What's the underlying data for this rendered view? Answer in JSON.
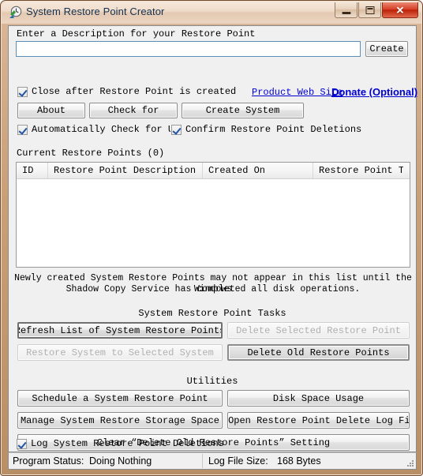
{
  "window": {
    "title": "System Restore Point Creator",
    "icon": "clock-restore-icon",
    "buttons": {
      "minimize": "minimize-button",
      "maximize": "maximize-button",
      "close_glyph": "✕"
    }
  },
  "description_section": {
    "label": "Enter a Description for your Restore Point",
    "input_value": "",
    "input_placeholder": "",
    "create_label": "Create"
  },
  "options": {
    "close_after": {
      "label": "Close after Restore Point is created",
      "checked": true
    },
    "auto_check_updates": {
      "label": "Automatically Check for Updat",
      "checked": true
    },
    "confirm_deletions": {
      "label": "Confirm Restore Point Deletions",
      "checked": true
    },
    "log_deletions": {
      "label": "Log System Restore Point Deletions",
      "checked": true
    }
  },
  "links": {
    "product_web_site": "Product Web Site",
    "donate": "Donate (Optional)"
  },
  "top_buttons": [
    {
      "label": "About",
      "enabled": true
    },
    {
      "label": "Check for",
      "enabled": true
    },
    {
      "label": "Create System",
      "enabled": true
    }
  ],
  "list_section": {
    "title": "Current Restore Points (0)",
    "columns": [
      "ID",
      "Restore Point Description",
      "Created On",
      "Restore Point Type"
    ],
    "rows": [],
    "note_line1": "Newly created System Restore Points may not appear in this list until the Windows",
    "note_line2": "Shadow Copy Service has completed all disk operations."
  },
  "tasks_section": {
    "title": "System Restore Point Tasks",
    "buttons": [
      {
        "label": "Refresh List of System Restore Points",
        "enabled": true,
        "focused": true
      },
      {
        "label": "Delete Selected Restore Point",
        "enabled": false,
        "focused": false
      },
      {
        "label": "Restore System to Selected System",
        "enabled": false,
        "focused": false
      },
      {
        "label": "Delete Old Restore Points",
        "enabled": true,
        "focused": true
      }
    ]
  },
  "utilities_section": {
    "title": "Utilities",
    "buttons": [
      {
        "label": "Schedule a System Restore Point",
        "enabled": true,
        "icon": ""
      },
      {
        "label": "Disk Space Usage",
        "enabled": true,
        "icon": ""
      },
      {
        "label": "Manage System Restore Storage Space",
        "enabled": true,
        "icon": ""
      },
      {
        "label": "Open Restore Point Delete Log File",
        "enabled": true,
        "icon": "log-file-icon"
      },
      {
        "label": "Clear “Delete Old Restore Points” Setting",
        "enabled": true,
        "icon": ""
      }
    ]
  },
  "status_bar": {
    "program_status_label": "Program Status:",
    "program_status_value": "Doing Nothing",
    "log_size_label": "Log File Size:",
    "log_size_value": "168 Bytes"
  },
  "colors": {
    "frame": "#b98f66",
    "link": "#0000d0",
    "check": "#2254a4",
    "close_button": "#bc2208"
  }
}
